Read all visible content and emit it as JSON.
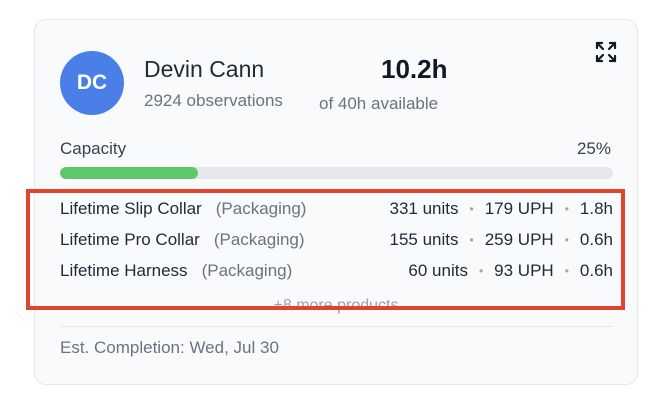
{
  "user": {
    "initials": "DC",
    "avatar_color": "#4a7fe8",
    "name": "Devin Cann",
    "observations": "2924 observations"
  },
  "time": {
    "hours": "10.2h",
    "available": "of 40h available"
  },
  "expand_icon": "expand-icon",
  "capacity": {
    "label": "Capacity",
    "percent_text": "25%",
    "fraction": 0.25,
    "bar_color": "#5ec76a"
  },
  "products": [
    {
      "name": "Lifetime Slip Collar",
      "category": "(Packaging)",
      "units": "331 units",
      "uph": "179 UPH",
      "hours": "1.8h"
    },
    {
      "name": "Lifetime Pro Collar",
      "category": "(Packaging)",
      "units": "155 units",
      "uph": "259 UPH",
      "hours": "0.6h"
    },
    {
      "name": "Lifetime Harness",
      "category": "(Packaging)",
      "units": "60 units",
      "uph": "93 UPH",
      "hours": "0.6h"
    }
  ],
  "more_products": "+8 more products",
  "completion": "Est. Completion: Wed, Jul 30",
  "highlight_color": "#e0442c"
}
